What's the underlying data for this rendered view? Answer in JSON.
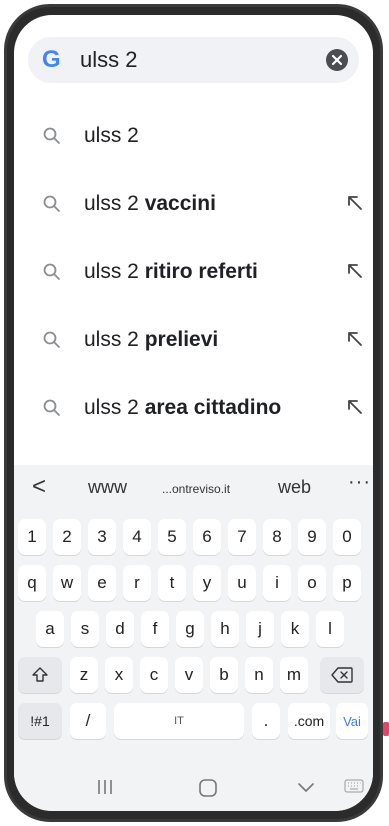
{
  "search": {
    "value": "ulss 2",
    "logo": "G"
  },
  "suggestions": [
    {
      "prefix": "ulss 2",
      "bold": "",
      "has_arrow": false
    },
    {
      "prefix": "ulss 2 ",
      "bold": "vaccini",
      "has_arrow": true
    },
    {
      "prefix": "ulss 2 ",
      "bold": "ritiro referti",
      "has_arrow": true
    },
    {
      "prefix": "ulss 2 ",
      "bold": "prelievi",
      "has_arrow": true
    },
    {
      "prefix": "ulss 2 ",
      "bold": "area cittadino",
      "has_arrow": true
    }
  ],
  "keyboard": {
    "predictions": {
      "back": "<",
      "item1": "www",
      "item2": "...ontreviso.it",
      "item3": "web",
      "more": "···"
    },
    "number_row": [
      "1",
      "2",
      "3",
      "4",
      "5",
      "6",
      "7",
      "8",
      "9",
      "0"
    ],
    "row1": [
      "q",
      "w",
      "e",
      "r",
      "t",
      "y",
      "u",
      "i",
      "o",
      "p"
    ],
    "row2": [
      "a",
      "s",
      "d",
      "f",
      "g",
      "h",
      "j",
      "k",
      "l"
    ],
    "row3": [
      "z",
      "x",
      "c",
      "v",
      "b",
      "n",
      "m"
    ],
    "symbols_key": "!#1",
    "slash_key": "/",
    "space_label": "IT",
    "period_key": ".",
    "dotcom_key": ".com",
    "go_key": "Vai"
  },
  "icons": {
    "clear": "clear-circle-icon",
    "search": "magnifier-icon",
    "fill_arrow": "arrow-up-left-icon",
    "shift": "shift-icon",
    "backspace": "backspace-icon",
    "recents": "recents-icon",
    "home": "home-icon",
    "back": "back-chevron-icon",
    "keyboard": "keyboard-icon"
  },
  "colors": {
    "accent": "#3f7ae8",
    "search_bg": "#f0f2f5",
    "keyboard_bg": "#f2f3f5"
  }
}
